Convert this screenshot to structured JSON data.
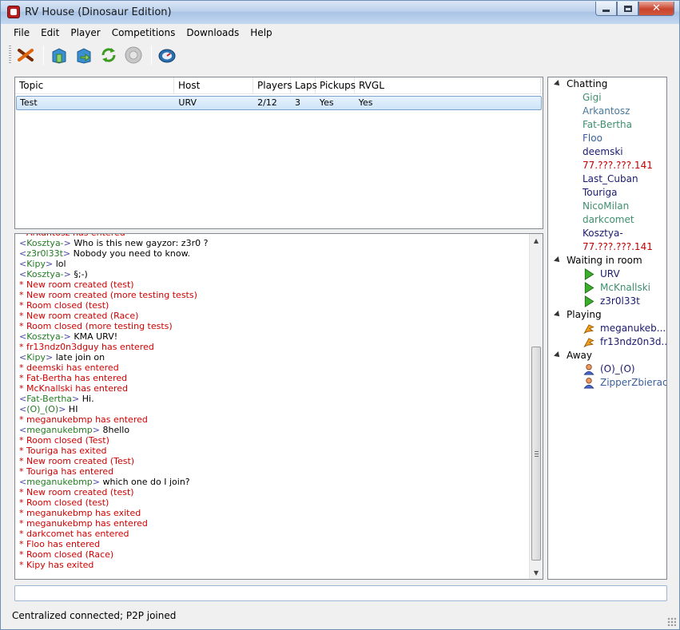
{
  "window": {
    "title": "RV House (Dinosaur Edition)"
  },
  "menu": [
    "File",
    "Edit",
    "Player",
    "Competitions",
    "Downloads",
    "Help"
  ],
  "toolbar": [
    "disconnect-icon",
    "host-room-icon",
    "join-room-icon",
    "refresh-icon",
    "disabled-disc-icon",
    "speedometer-icon"
  ],
  "rooms": {
    "headers": [
      "Topic",
      "Host",
      "Players",
      "Laps",
      "Pickups",
      "RVGL"
    ],
    "rows": [
      {
        "topic": "Test",
        "host": "URV",
        "players": "2/12",
        "laps": "3",
        "pickups": "Yes",
        "rvgl": "Yes"
      }
    ]
  },
  "chat": [
    {
      "kind": "sys",
      "text": "Arkantosz has entered"
    },
    {
      "kind": "msg",
      "nick": "Kosztya-",
      "text": "Who is this new gayzor: z3r0 ?"
    },
    {
      "kind": "msg",
      "nick": "z3r0l33t",
      "text": "Nobody you need to know."
    },
    {
      "kind": "msg",
      "nick": "Kipy",
      "text": "lol"
    },
    {
      "kind": "msg",
      "nick": "Kosztya-",
      "text": "§;-)"
    },
    {
      "kind": "sys",
      "text": "New room created (test)"
    },
    {
      "kind": "sys",
      "text": "New room created (more testing tests)"
    },
    {
      "kind": "sys",
      "text": "Room closed (test)"
    },
    {
      "kind": "sys",
      "text": "New room created (Race)"
    },
    {
      "kind": "sys",
      "text": "Room closed (more testing tests)"
    },
    {
      "kind": "msg",
      "nick": "Kosztya-",
      "text": "KMA URV!"
    },
    {
      "kind": "sys",
      "text": "fr13ndz0n3dguy has entered"
    },
    {
      "kind": "msg",
      "nick": "Kipy",
      "text": "late join on"
    },
    {
      "kind": "sys",
      "text": "deemski has entered"
    },
    {
      "kind": "sys",
      "text": "Fat-Bertha has entered"
    },
    {
      "kind": "sys",
      "text": "McKnallski has entered"
    },
    {
      "kind": "msg",
      "nick": "Fat-Bertha",
      "text": "Hi."
    },
    {
      "kind": "msg",
      "nick": "(O)_(O)",
      "text": "HI"
    },
    {
      "kind": "sys",
      "text": "meganukebmp has entered"
    },
    {
      "kind": "msg",
      "nick": "meganukebmp",
      "text": "8hello"
    },
    {
      "kind": "sys",
      "text": "Room closed (Test)"
    },
    {
      "kind": "sys",
      "text": "Touriga has exited"
    },
    {
      "kind": "sys",
      "text": "New room created (Test)"
    },
    {
      "kind": "sys",
      "text": "Touriga has entered"
    },
    {
      "kind": "msg",
      "nick": "meganukebmp",
      "text": "which one do I join?"
    },
    {
      "kind": "sys",
      "text": "New room created (test)"
    },
    {
      "kind": "sys",
      "text": "Room closed (test)"
    },
    {
      "kind": "sys",
      "text": "meganukebmp has exited"
    },
    {
      "kind": "sys",
      "text": "meganukebmp has entered"
    },
    {
      "kind": "sys",
      "text": "darkcomet has entered"
    },
    {
      "kind": "sys",
      "text": "Floo has entered"
    },
    {
      "kind": "sys",
      "text": "Room closed (Race)"
    },
    {
      "kind": "sys",
      "text": "Kipy has exited"
    }
  ],
  "users": {
    "chatting_label": "Chatting",
    "chatting": [
      {
        "name": "Gigi",
        "color": "#3f8f6f"
      },
      {
        "name": "Arkantosz",
        "color": "#4a7a9a"
      },
      {
        "name": "Fat-Bertha",
        "color": "#3f8f6f"
      },
      {
        "name": "Floo",
        "color": "#3a5f9a"
      },
      {
        "name": "deemski",
        "color": "#1a1a6e"
      },
      {
        "name": "77.???.???.141",
        "color": "#c00000"
      },
      {
        "name": "Last_Cuban",
        "color": "#1a1a6e"
      },
      {
        "name": "Touriga",
        "color": "#1a1a6e"
      },
      {
        "name": "NicoMilan",
        "color": "#3f8f6f"
      },
      {
        "name": "darkcomet",
        "color": "#3f8f6f"
      },
      {
        "name": "Kosztya-",
        "color": "#1a1a6e"
      },
      {
        "name": "77.???.???.141",
        "color": "#c00000"
      }
    ],
    "waiting_label": "Waiting in room",
    "waiting": [
      {
        "name": "URV",
        "color": "#1a1a6e"
      },
      {
        "name": "McKnallski",
        "color": "#3f8f6f"
      },
      {
        "name": "z3r0l33t",
        "color": "#1a1a6e"
      }
    ],
    "playing_label": "Playing",
    "playing": [
      {
        "name": "meganukeb...",
        "color": "#1a1a6e"
      },
      {
        "name": "fr13ndz0n3d...",
        "color": "#1a1a6e"
      }
    ],
    "away_label": "Away",
    "away": [
      {
        "name": "(O)_(O)",
        "color": "#1a1a6e"
      },
      {
        "name": "ZipperZbieracz",
        "color": "#3a5f9a"
      }
    ]
  },
  "chat_input": {
    "value": ""
  },
  "status": "Centralized connected; P2P joined"
}
